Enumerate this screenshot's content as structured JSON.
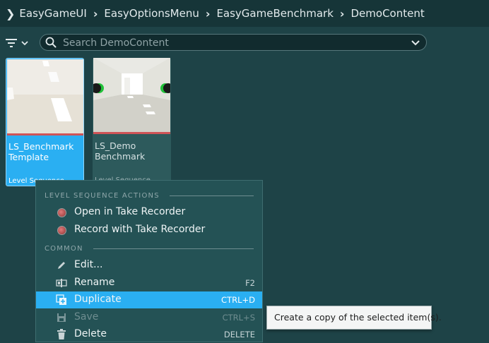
{
  "breadcrumb": {
    "items": [
      "EasyGameUI",
      "EasyOptionsMenu",
      "EasyGameBenchmark",
      "DemoContent"
    ]
  },
  "toolbar": {
    "filter_icon": "filter-icon",
    "search_placeholder": "Search DemoContent"
  },
  "assets": [
    {
      "name": "LS_Benchmark Template",
      "name_line1": "LS_Benchmark",
      "name_line2": "Template",
      "type": "Level Sequence",
      "selected": true
    },
    {
      "name": "LS_Demo Benchmark",
      "name_line1": "LS_Demo",
      "name_line2": "Benchmark",
      "type": "Level Sequence",
      "selected": false
    }
  ],
  "context_menu": {
    "section_1": "LEVEL SEQUENCE ACTIONS",
    "section_2": "COMMON",
    "items": [
      {
        "label": "Open in Take Recorder",
        "shortcut": "",
        "icon": "take-recorder-icon"
      },
      {
        "label": "Record with Take Recorder",
        "shortcut": "",
        "icon": "take-recorder-icon"
      },
      {
        "label": "Edit...",
        "shortcut": "",
        "icon": "pencil-icon"
      },
      {
        "label": "Rename",
        "shortcut": "F2",
        "icon": "rename-icon"
      },
      {
        "label": "Duplicate",
        "shortcut": "CTRL+D",
        "icon": "duplicate-icon",
        "highlighted": true
      },
      {
        "label": "Save",
        "shortcut": "CTRL+S",
        "icon": "save-icon",
        "disabled": true
      },
      {
        "label": "Delete",
        "shortcut": "DELETE",
        "icon": "trash-icon"
      }
    ]
  },
  "tooltip": {
    "text": "Create a copy of the selected item(s)."
  },
  "colors": {
    "background": "#1e4347",
    "selection": "#2aaff2",
    "menu": "#245255",
    "asset_bar": "#cf5457"
  }
}
